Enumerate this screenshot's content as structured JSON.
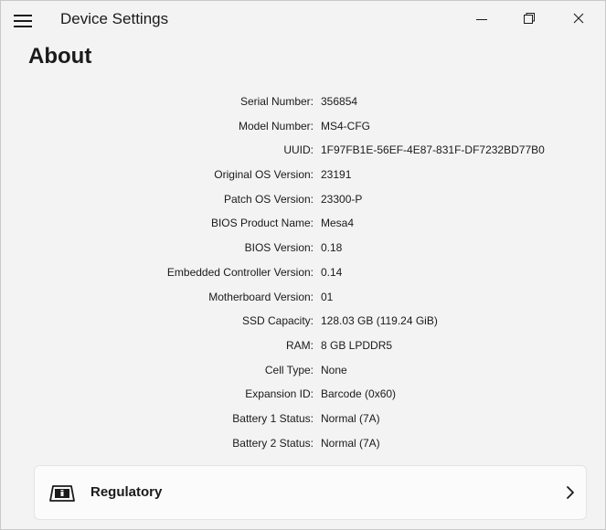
{
  "window": {
    "title": "Device Settings"
  },
  "page": {
    "title": "About"
  },
  "info": [
    {
      "label": "Serial Number:",
      "value": "356854"
    },
    {
      "label": "Model Number:",
      "value": "MS4-CFG"
    },
    {
      "label": "UUID:",
      "value": "1F97FB1E-56EF-4E87-831F-DF7232BD77B0"
    },
    {
      "label": "Original OS Version:",
      "value": "23191"
    },
    {
      "label": "Patch OS Version:",
      "value": "23300-P"
    },
    {
      "label": "BIOS Product Name:",
      "value": "Mesa4"
    },
    {
      "label": "BIOS Version:",
      "value": "0.18"
    },
    {
      "label": "Embedded Controller Version:",
      "value": "0.14"
    },
    {
      "label": "Motherboard Version:",
      "value": "01"
    },
    {
      "label": "SSD Capacity:",
      "value": "128.03 GB (119.24 GiB)"
    },
    {
      "label": "RAM:",
      "value": "8 GB LPDDR5"
    },
    {
      "label": "Cell Type:",
      "value": "None"
    },
    {
      "label": "Expansion ID:",
      "value": "Barcode (0x60)"
    },
    {
      "label": "Battery 1 Status:",
      "value": "Normal (7A)"
    },
    {
      "label": "Battery 2 Status:",
      "value": "Normal (7A)"
    }
  ],
  "regulatory": {
    "label": "Regulatory",
    "icon": "regulatory-device-icon"
  },
  "icons": {
    "menu": "hamburger-menu-icon",
    "minimize": "minimize-icon",
    "maximize": "restore-icon",
    "close": "close-icon",
    "chevron": "chevron-right-icon"
  }
}
